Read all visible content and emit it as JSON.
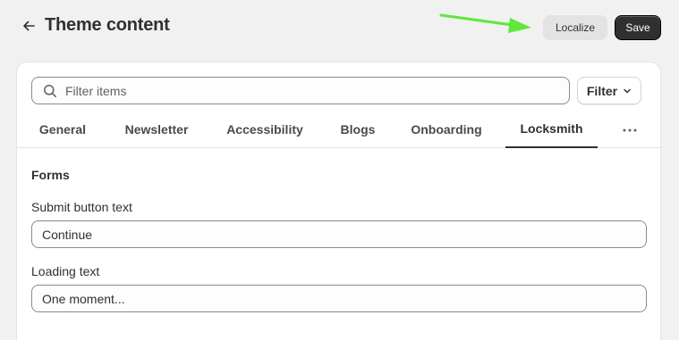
{
  "header": {
    "back_icon": "arrow-left-icon",
    "title": "Theme content",
    "localize_label": "Localize",
    "save_label": "Save",
    "annotation_color": "#5fe83a"
  },
  "toolbar": {
    "search_placeholder": "Filter items",
    "search_value": "",
    "search_icon": "search-icon",
    "filter_label": "Filter",
    "filter_icon": "chevron-down-icon"
  },
  "tabs": [
    {
      "label": "General",
      "active": false
    },
    {
      "label": "Newsletter",
      "active": false
    },
    {
      "label": "Accessibility",
      "active": false
    },
    {
      "label": "Blogs",
      "active": false
    },
    {
      "label": "Onboarding",
      "active": false
    },
    {
      "label": "Locksmith",
      "active": true
    }
  ],
  "more_tabs_icon": "ellipsis-horizontal-icon",
  "section": {
    "title": "Forms",
    "fields": [
      {
        "label": "Submit button text",
        "value": "Continue"
      },
      {
        "label": "Loading text",
        "value": "One moment..."
      }
    ]
  }
}
